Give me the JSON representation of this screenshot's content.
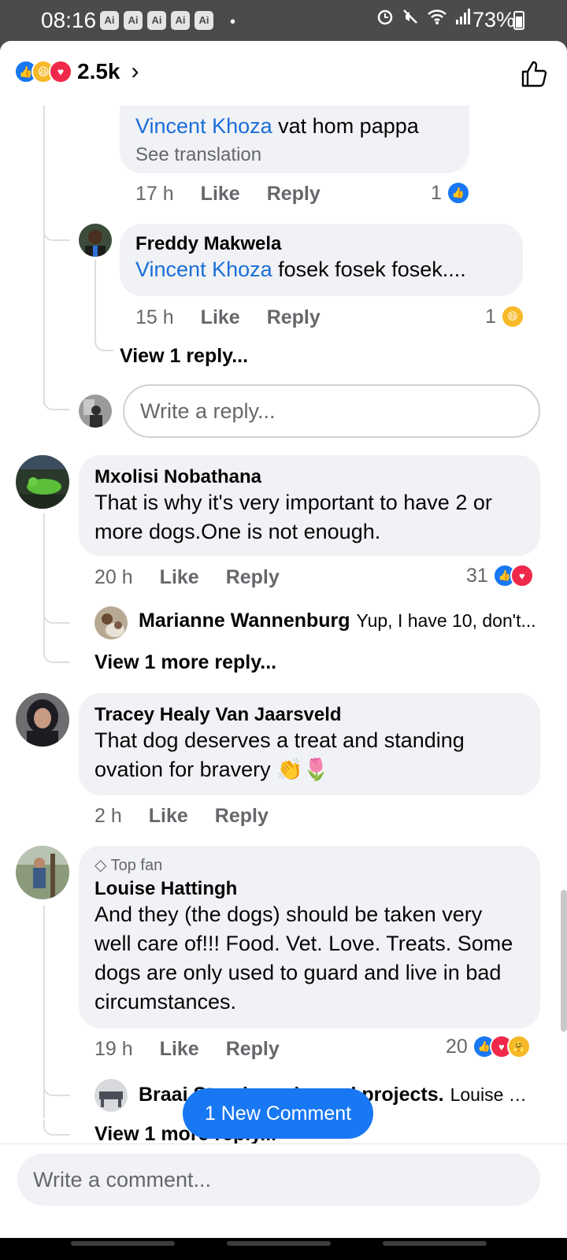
{
  "status": {
    "time": "08:16",
    "ai_badges": [
      "Ai",
      "Ai",
      "Ai",
      "Ai",
      "Ai"
    ],
    "dot": "•",
    "battery": "73%",
    "icons": [
      "alarm-icon",
      "mute-icon",
      "wifi-icon",
      "signal-icon",
      "battery-icon"
    ]
  },
  "header": {
    "reaction_total": "2.5k",
    "chevron": "›"
  },
  "thread1": {
    "reply1": {
      "mention": "Vincent Khoza",
      "text": " vat hom pappa",
      "translate": "See translation",
      "time": "17 h",
      "like": "Like",
      "reply": "Reply",
      "reactions": "1"
    },
    "reply2": {
      "author": "Freddy Makwela",
      "mention": "Vincent Khoza",
      "text": " fosek fosek fosek....",
      "time": "15 h",
      "like": "Like",
      "reply": "Reply",
      "reactions": "1"
    },
    "view_reply": "View 1 reply...",
    "reply_placeholder": "Write a reply..."
  },
  "comments": [
    {
      "author": "Mxolisi Nobathana",
      "text": "That is why it's very important to have 2 or more dogs.One is not enough.",
      "time": "20 h",
      "like": "Like",
      "reply": "Reply",
      "reactions": "31",
      "preview_author": "Marianne Wannenburg",
      "preview_text": "Yup, I have 10, don't...",
      "view_more": "View 1 more reply..."
    },
    {
      "author": "Tracey Healy Van Jaarsveld",
      "text": "That dog deserves a treat and standing ovation for bravery 👏🌷",
      "time": "2 h",
      "like": "Like",
      "reply": "Reply"
    },
    {
      "badge": "Top fan",
      "author": "Louise Hattingh",
      "text": "And they (the dogs) should be taken very well care of!!! Food. Vet. Love. Treats. Some dogs are only used to guard and live in bad circumstances.",
      "time": "19 h",
      "like": "Like",
      "reply": "Reply",
      "reactions": "20",
      "preview_author": "Braai Stands and wood projects.",
      "preview_text": "Louise H...",
      "view_more": "View 1 more reply..."
    }
  ],
  "new_comment_pill": "1 New Comment",
  "composer_placeholder": "Write a comment...",
  "colors": {
    "accent": "#1877f2",
    "mention": "#1a6ed8",
    "bubble": "#f0f2f5",
    "meta": "#65676b",
    "love": "#f02849",
    "haha": "#f7b928"
  }
}
